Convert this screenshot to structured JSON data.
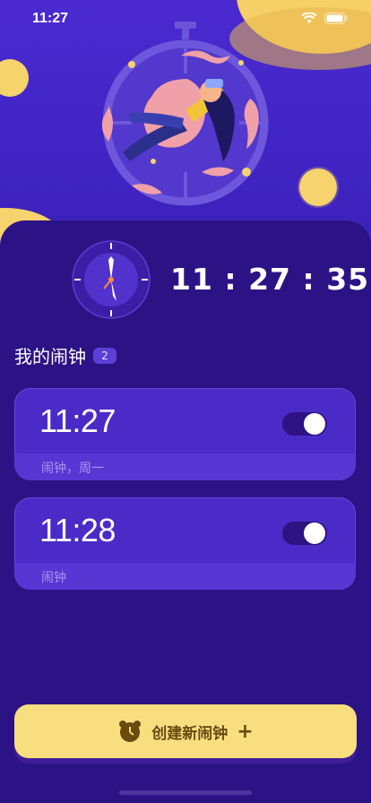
{
  "status_bar": {
    "time": "11:27"
  },
  "clock": {
    "digital_time": "11 : 27 : 35"
  },
  "alarms_section": {
    "title": "我的闹钟",
    "count": "2"
  },
  "alarms": [
    {
      "time": "11:27",
      "label": "闹钟，周一",
      "enabled": true
    },
    {
      "time": "11:28",
      "label": "闹钟",
      "enabled": true
    }
  ],
  "create_button": {
    "label": "创建新闹钟",
    "plus": "+"
  },
  "colors": {
    "background": "#2b1182",
    "card": "#4b2bc7",
    "accent": "#f8de7f"
  }
}
